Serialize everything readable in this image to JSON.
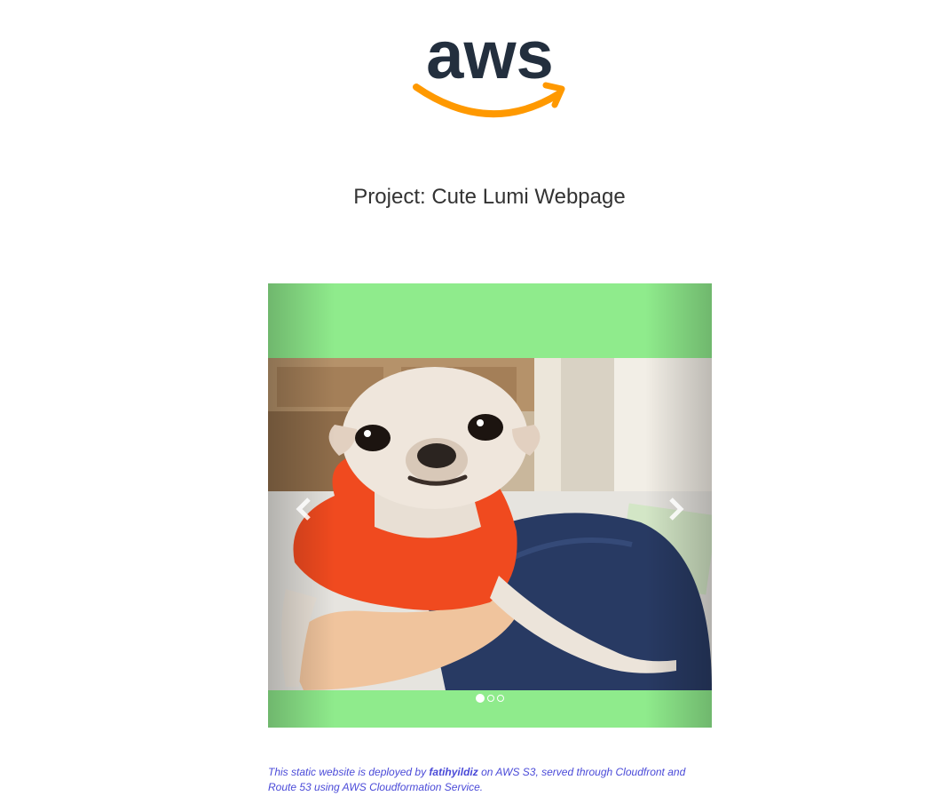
{
  "logo": {
    "text": "aws",
    "text_color": "#232f3e",
    "smile_color": "#ff9900"
  },
  "page": {
    "title": "Project: Cute Lumi Webpage"
  },
  "carousel": {
    "background_color": "#8feb8c",
    "slide_count": 3,
    "active_slide": 1,
    "photo_subject": "chihuahua-in-red-hoodie",
    "prev_icon": "chevron-left-icon",
    "next_icon": "chevron-right-icon"
  },
  "footer": {
    "prefix": "This static website is deployed by ",
    "author": "fatihyildiz",
    "suffix": " on AWS S3, served through Cloudfront and Route 53 using AWS Cloudformation Service.",
    "text_color": "#4a4ad8"
  }
}
